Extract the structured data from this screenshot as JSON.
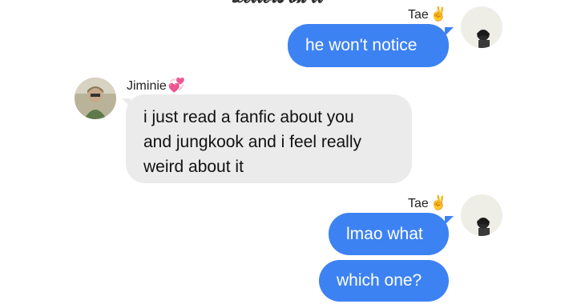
{
  "top_text": "𝓛𝓮𝓽𝓽𝓮𝓻𝓼 𝓸𝓷 𝓲𝓽",
  "messages": [
    {
      "sender": "Tae",
      "sender_emoji": "✌️",
      "lines": [
        "he won't notice"
      ]
    },
    {
      "sender": "Jiminie",
      "sender_emoji": "💞",
      "lines": [
        "i just read a fanfic about you",
        "and jungkook and i feel really",
        "weird about it"
      ]
    },
    {
      "sender": "Tae",
      "sender_emoji": "✌️",
      "lines": [
        "lmao what"
      ]
    },
    {
      "sender": "",
      "sender_emoji": "",
      "lines": [
        "which one?"
      ]
    }
  ],
  "colors": {
    "outgoing_bubble": "#3d82f2",
    "incoming_bubble": "#ebebeb",
    "outgoing_text": "#ffffff",
    "incoming_text": "#111111"
  }
}
